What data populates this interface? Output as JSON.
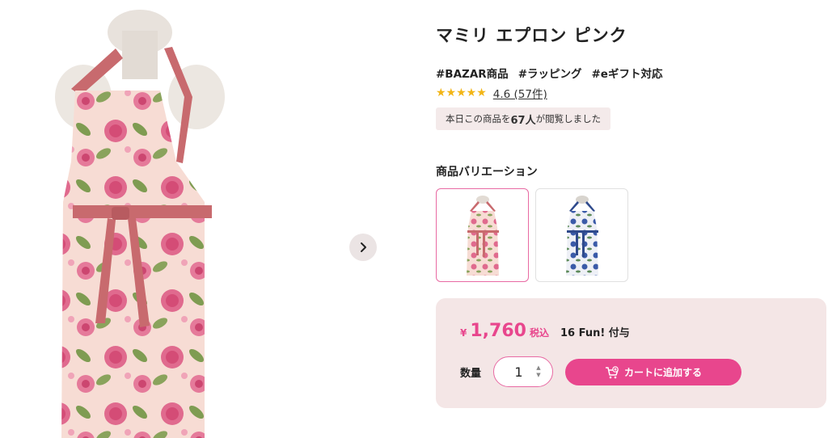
{
  "product": {
    "title": "マミリ エプロン ピンク",
    "tags": [
      "#BAZAR商品",
      "#ラッピング",
      "#eギフト対応"
    ],
    "rating": {
      "stars": "★★★★★",
      "value": 4.6,
      "link_text": "4.6 (57件)"
    },
    "viewers": {
      "prefix": "本日この商品を",
      "count": "67人",
      "suffix": "が閲覧しました"
    }
  },
  "gallery": {
    "next_icon": "chevron-right-icon"
  },
  "variations": {
    "heading": "商品バリエーション",
    "items": [
      {
        "name": "pink",
        "selected": true
      },
      {
        "name": "blue",
        "selected": false
      }
    ]
  },
  "purchase": {
    "currency": "¥",
    "price": "1,760",
    "tax_label": "税込",
    "points": "16 Fun! 付与",
    "quantity_label": "数量",
    "quantity_value": "1",
    "add_to_cart_label": "カートに追加する",
    "cart_icon": "cart-plus-icon"
  },
  "colors": {
    "accent": "#e8468d",
    "panel": "#f4e6e6",
    "star": "#f2b516"
  }
}
